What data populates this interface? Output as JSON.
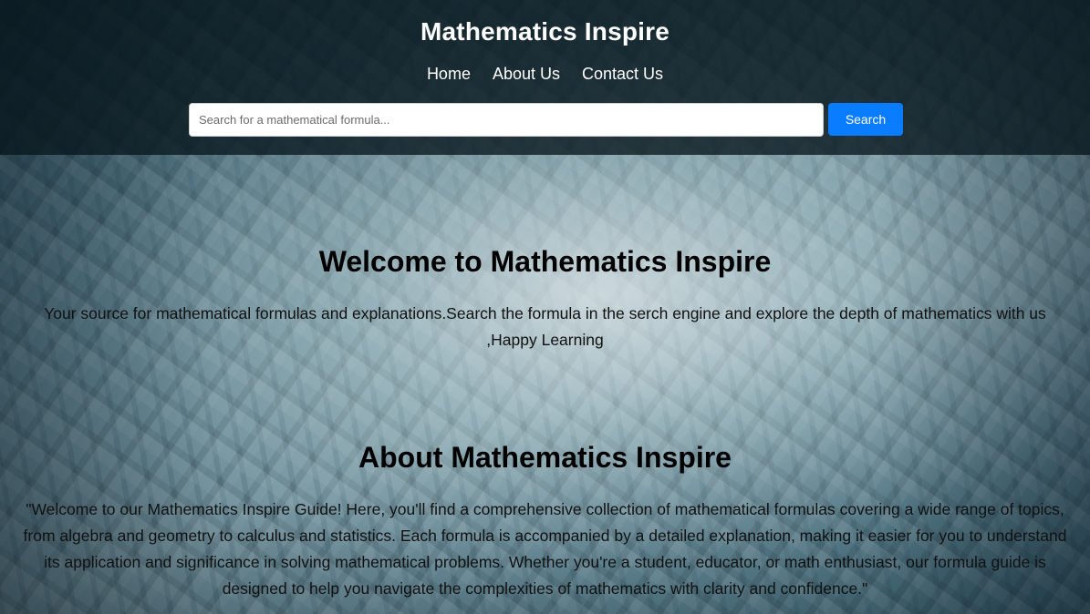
{
  "header": {
    "title": "Mathematics Inspire",
    "nav": [
      {
        "label": "Home"
      },
      {
        "label": "About Us"
      },
      {
        "label": "Contact Us"
      }
    ],
    "search": {
      "placeholder": "Search for a mathematical formula...",
      "value": "",
      "button_label": "Search"
    }
  },
  "main": {
    "welcome": {
      "heading": "Welcome to Mathematics Inspire",
      "text": "Your source for mathematical formulas and explanations.Search the formula in the serch engine and explore the depth of mathematics with us ,Happy Learning"
    },
    "about": {
      "heading": "About Mathematics Inspire",
      "text": "\"Welcome to our Mathematics Inspire Guide! Here, you'll find a comprehensive collection of mathematical formulas covering a wide range of topics, from algebra and geometry to calculus and statistics. Each formula is accompanied by a detailed explanation, making it easier for you to understand its application and significance in solving mathematical problems. Whether you're a student, educator, or math enthusiast, our formula guide is designed to help you navigate the complexities of mathematics with clarity and confidence.\""
    }
  },
  "colors": {
    "header_bg": "#08161c",
    "search_button": "#0a7cff",
    "title_text": "#ffffff"
  }
}
